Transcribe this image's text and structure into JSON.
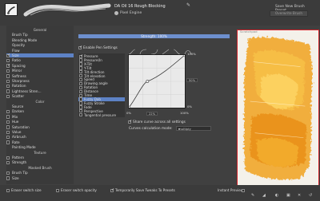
{
  "header": {
    "preset_name": "DA Oil 16 Rough Blocking",
    "engine_label": "Pixel Engine",
    "save_new_label": "Save New Brush Preset...",
    "overwrite_label": "Overwrite Brush"
  },
  "options": {
    "items": [
      {
        "label": "General",
        "type": "section"
      },
      {
        "label": "Brush Tip",
        "type": "plain"
      },
      {
        "label": "Blending Mode",
        "type": "plain"
      },
      {
        "label": "Opacity",
        "type": "plain"
      },
      {
        "label": "Flow",
        "type": "plain"
      },
      {
        "label": "Size",
        "type": "check",
        "checked": true,
        "selected": true
      },
      {
        "label": "Ratio",
        "type": "check",
        "checked": false
      },
      {
        "label": "Spacing",
        "type": "check",
        "checked": true
      },
      {
        "label": "Mirror",
        "type": "check",
        "checked": false
      },
      {
        "label": "Softness",
        "type": "check",
        "checked": false
      },
      {
        "label": "Sharpness",
        "type": "check",
        "checked": false
      },
      {
        "label": "Rotation",
        "type": "check",
        "checked": false
      },
      {
        "label": "Lightness Stren...",
        "type": "check",
        "checked": false
      },
      {
        "label": "Scatter",
        "type": "check",
        "checked": false
      },
      {
        "label": "Color",
        "type": "section"
      },
      {
        "label": "Source",
        "type": "plain"
      },
      {
        "label": "Darken",
        "type": "check",
        "checked": false
      },
      {
        "label": "Mix",
        "type": "check",
        "checked": false
      },
      {
        "label": "Hue",
        "type": "check",
        "checked": false
      },
      {
        "label": "Saturation",
        "type": "check",
        "checked": false
      },
      {
        "label": "Value",
        "type": "check",
        "checked": false
      },
      {
        "label": "Airbrush",
        "type": "check",
        "checked": false
      },
      {
        "label": "Rate",
        "type": "check",
        "checked": false
      },
      {
        "label": "Painting Mode",
        "type": "plain"
      },
      {
        "label": "Texture",
        "type": "section"
      },
      {
        "label": "Pattern",
        "type": "check",
        "checked": false
      },
      {
        "label": "Strength",
        "type": "check",
        "checked": false
      },
      {
        "label": "Masked Brush",
        "type": "section"
      },
      {
        "label": "Brush Tip",
        "type": "check",
        "checked": false
      },
      {
        "label": "Size",
        "type": "check",
        "checked": false
      }
    ]
  },
  "editor": {
    "strength_label": "Strength: 100%",
    "enable_pen_settings": "Enable Pen Settings",
    "sensors": [
      {
        "label": "Pressure",
        "checked": true
      },
      {
        "label": "Pressure(In",
        "checked": false
      },
      {
        "label": "X-Tilt",
        "checked": false
      },
      {
        "label": "Y-Tilt",
        "checked": false
      },
      {
        "label": "Tilt direction",
        "checked": false
      },
      {
        "label": "Tilt elevation",
        "checked": false
      },
      {
        "label": "Speed",
        "checked": false
      },
      {
        "label": "Drawing angle",
        "checked": false
      },
      {
        "label": "Rotation",
        "checked": false
      },
      {
        "label": "Distance",
        "checked": false
      },
      {
        "label": "Time",
        "checked": false
      },
      {
        "label": "Fuzzy Dab",
        "checked": false,
        "selected": true
      },
      {
        "label": "Fuzzy Stroke",
        "checked": false
      },
      {
        "label": "Fade",
        "checked": false
      },
      {
        "label": "Perspective",
        "checked": false
      },
      {
        "label": "Tangential pressure",
        "checked": false
      }
    ],
    "y_max": "100%",
    "y_min": "0%",
    "y_value": "50%",
    "x_value": "22%",
    "x_min": "0%",
    "x_max": "100%",
    "share_curve_label": "Share curve across all settings",
    "calc_mode_label": "Curves calculation mode:",
    "calc_mode_value": "multiply"
  },
  "preview": {
    "title": "Scratchpad"
  },
  "footer": {
    "erase_switch_size": "Eraser switch size",
    "erase_switch_opacity": "Eraser switch opacity",
    "temporarily_save": "Temporarily Save Tweaks To Presets",
    "instant_preview": "Instant Preview"
  },
  "colors": {
    "accent": "#5d82c5",
    "highlight_border": "#d0232a",
    "paint": "#f0a21e"
  }
}
